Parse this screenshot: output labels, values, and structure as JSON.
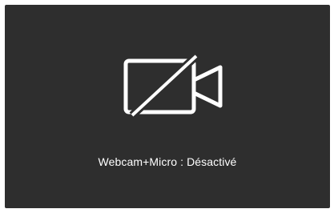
{
  "overlay": {
    "status_text": "Webcam+Micro : Désactivé",
    "icon": "video-camera-off-icon",
    "background_color": "#2e2e2e",
    "text_color": "#ffffff"
  }
}
